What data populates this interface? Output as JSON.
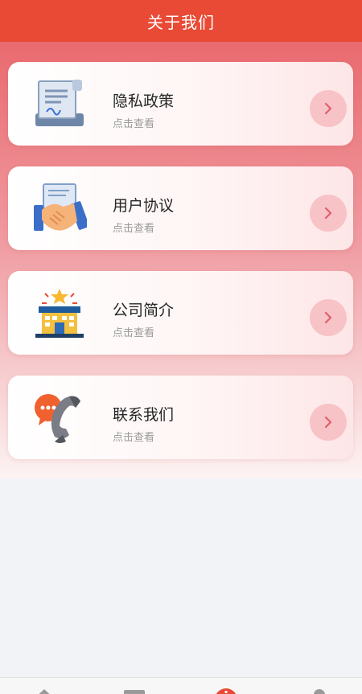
{
  "header": {
    "title": "关于我们"
  },
  "cards": [
    {
      "title": "隐私政策",
      "subtitle": "点击查看",
      "icon": "privacy-document-icon"
    },
    {
      "title": "用户协议",
      "subtitle": "点击查看",
      "icon": "handshake-agreement-icon"
    },
    {
      "title": "公司简介",
      "subtitle": "点击查看",
      "icon": "company-building-icon"
    },
    {
      "title": "联系我们",
      "subtitle": "点击查看",
      "icon": "phone-chat-icon"
    }
  ],
  "tabbar": {
    "items": [
      {
        "icon": "home-icon"
      },
      {
        "icon": "list-icon"
      },
      {
        "icon": "info-icon",
        "active": true
      },
      {
        "icon": "user-icon"
      }
    ]
  },
  "colors": {
    "header": "#e94a35",
    "arrow_bg": "#f7c3c6",
    "arrow": "#e0606a"
  }
}
